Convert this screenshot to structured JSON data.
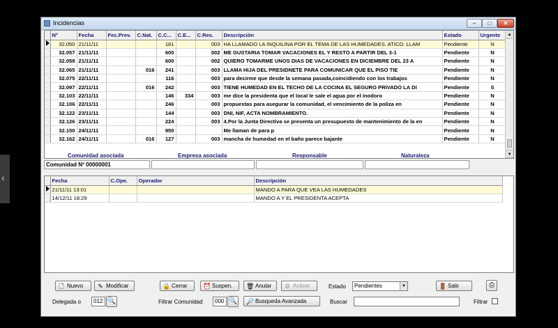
{
  "window": {
    "title": "Incidencias",
    "min": "–",
    "max": "□",
    "close": "✕"
  },
  "grid1": {
    "headers": [
      "Nº",
      "Fecha",
      "Fec.Prev.",
      "C.Nat.",
      "C.C...",
      "C.E...",
      "C.Res.",
      "Descripción",
      "Estado",
      "Urgente"
    ],
    "rows": [
      [
        "32.050",
        "21/11/11",
        "",
        "",
        "181",
        "",
        "003",
        "HA LLAMADO LA INQUILINA            POR EL TEMA DE LAS HUMEDADES. ATICO. LLAM",
        "Pendiente",
        "N"
      ],
      [
        "32.057",
        "21/11/11",
        "",
        "",
        "600",
        "",
        "002",
        "ME GUSTARIA TOMAR VACACIONES EL              Y RESTO A PARTIR DEL 3-1",
        "Pendiente",
        "N"
      ],
      [
        "32.058",
        "21/11/11",
        "",
        "",
        "600",
        "",
        "002",
        "QUIERO  TOMARME  UNOS DIAS DE VACACIONES EN DICIEMBRE DEL 23 A",
        "Pendiente",
        "N"
      ],
      [
        "32.065",
        "21/11/11",
        "",
        "016",
        "241",
        "",
        "003",
        "LLAMA       HIJA DEL PRESIDNETE PARA COMUNICAR QUE EL PISO      TIE",
        "Pendiente",
        "N"
      ],
      [
        "32.075",
        "22/11/11",
        "",
        "",
        "116",
        "",
        "003",
        "           para decirme que desde la semana pasada,coincidiendo con los trabajos",
        "Pendiente",
        "N"
      ],
      [
        "32.097",
        "22/11/11",
        "",
        "016",
        "242",
        "",
        "003",
        "TIENE HUMEDAD EN EL TECHO DE LA COCINA EL SEGURO PRIVADO LA DI",
        "Pendiente",
        "S"
      ],
      [
        "32.103",
        "22/11/11",
        "",
        "",
        "146",
        "334",
        "003",
        "me dice la presidenta que el local          le sale el agua por el inodoro",
        "Pendiente",
        "N"
      ],
      [
        "32.106",
        "22/11/11",
        "",
        "",
        "246",
        "",
        "003",
        "propuestas para asegurar la comunidad,          el vencimiento de la poliza en",
        "Pendiente",
        "N"
      ],
      [
        "32.122",
        "23/11/11",
        "",
        "",
        "144",
        "",
        "003",
        "DNI, NIF, ACTA NOMBRAMIENTO.",
        "Pendiente",
        "N"
      ],
      [
        "32.126",
        "23/11/11",
        "",
        "",
        "224",
        "",
        "003",
        "4.Por la Junta Directiva se presenta un presupuesto de mantenimiento   de la en",
        "Pendiente",
        "N"
      ],
      [
        "32.150",
        "24/11/11",
        "",
        "",
        "950",
        "",
        "",
        "Me llaman de                                                              para p",
        "Pendiente",
        "N"
      ],
      [
        "32.162",
        "24/11/11",
        "",
        "016",
        "127",
        "",
        "003",
        "mancha de humedad en el baño parece bajante",
        "Pendiente",
        "N"
      ]
    ]
  },
  "assoc": {
    "comunidad_label": "Comunidad asociada",
    "empresa_label": "Empresa asociada",
    "responsable_label": "Responsable",
    "naturaleza_label": "Naturaleza",
    "comunidad_value": "Comunidad Nº 00000001"
  },
  "grid2": {
    "headers": [
      "Fecha",
      "C.Ope.",
      "Operador",
      "Descripción"
    ],
    "rows": [
      [
        "21/11/11  13:01",
        "",
        "",
        "MANDO A                    PARA QUE VEA LAS HUMEDADES"
      ],
      [
        "14/12/11  18:29",
        "",
        "",
        "MANDO A                    Y EL PRESIDENTA ACEPTA"
      ]
    ]
  },
  "toolbar": {
    "nuevo": "Nuevo",
    "modificar": "Modificar",
    "cerrar": "Cerrar",
    "suspen": "Suspen.",
    "anular": "Anular",
    "activar": "Activar",
    "estado_label": "Estado",
    "estado_value": "Pendientes",
    "salir": "Salir",
    "delegada_label": "Delegada o",
    "delegada_value": "012",
    "filtrar_comunidad_label": "Filtrar Comunidad",
    "filtrar_comunidad_value": "000",
    "busqueda_avanzada": "Busqueda Avanzada",
    "buscar_label": "Buscar",
    "buscar_value": "",
    "filtrar_label": "Filtrar"
  },
  "colors": {
    "accent": "#1a1a6e",
    "selected_row": "#fffbd6",
    "header_bg": "#f0f0f0"
  }
}
